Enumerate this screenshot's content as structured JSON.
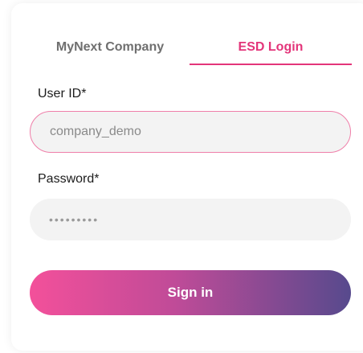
{
  "tabs": [
    {
      "label": "MyNext Company",
      "active": false
    },
    {
      "label": "ESD Login",
      "active": true
    }
  ],
  "form": {
    "user_label": "User ID*",
    "user_value": "company_demo",
    "password_label": "Password*",
    "password_value": "•••••••••",
    "submit_label": "Sign in"
  },
  "colors": {
    "accent": "#e3357a",
    "gradient_start": "#f3509a",
    "gradient_end": "#574a8d"
  }
}
